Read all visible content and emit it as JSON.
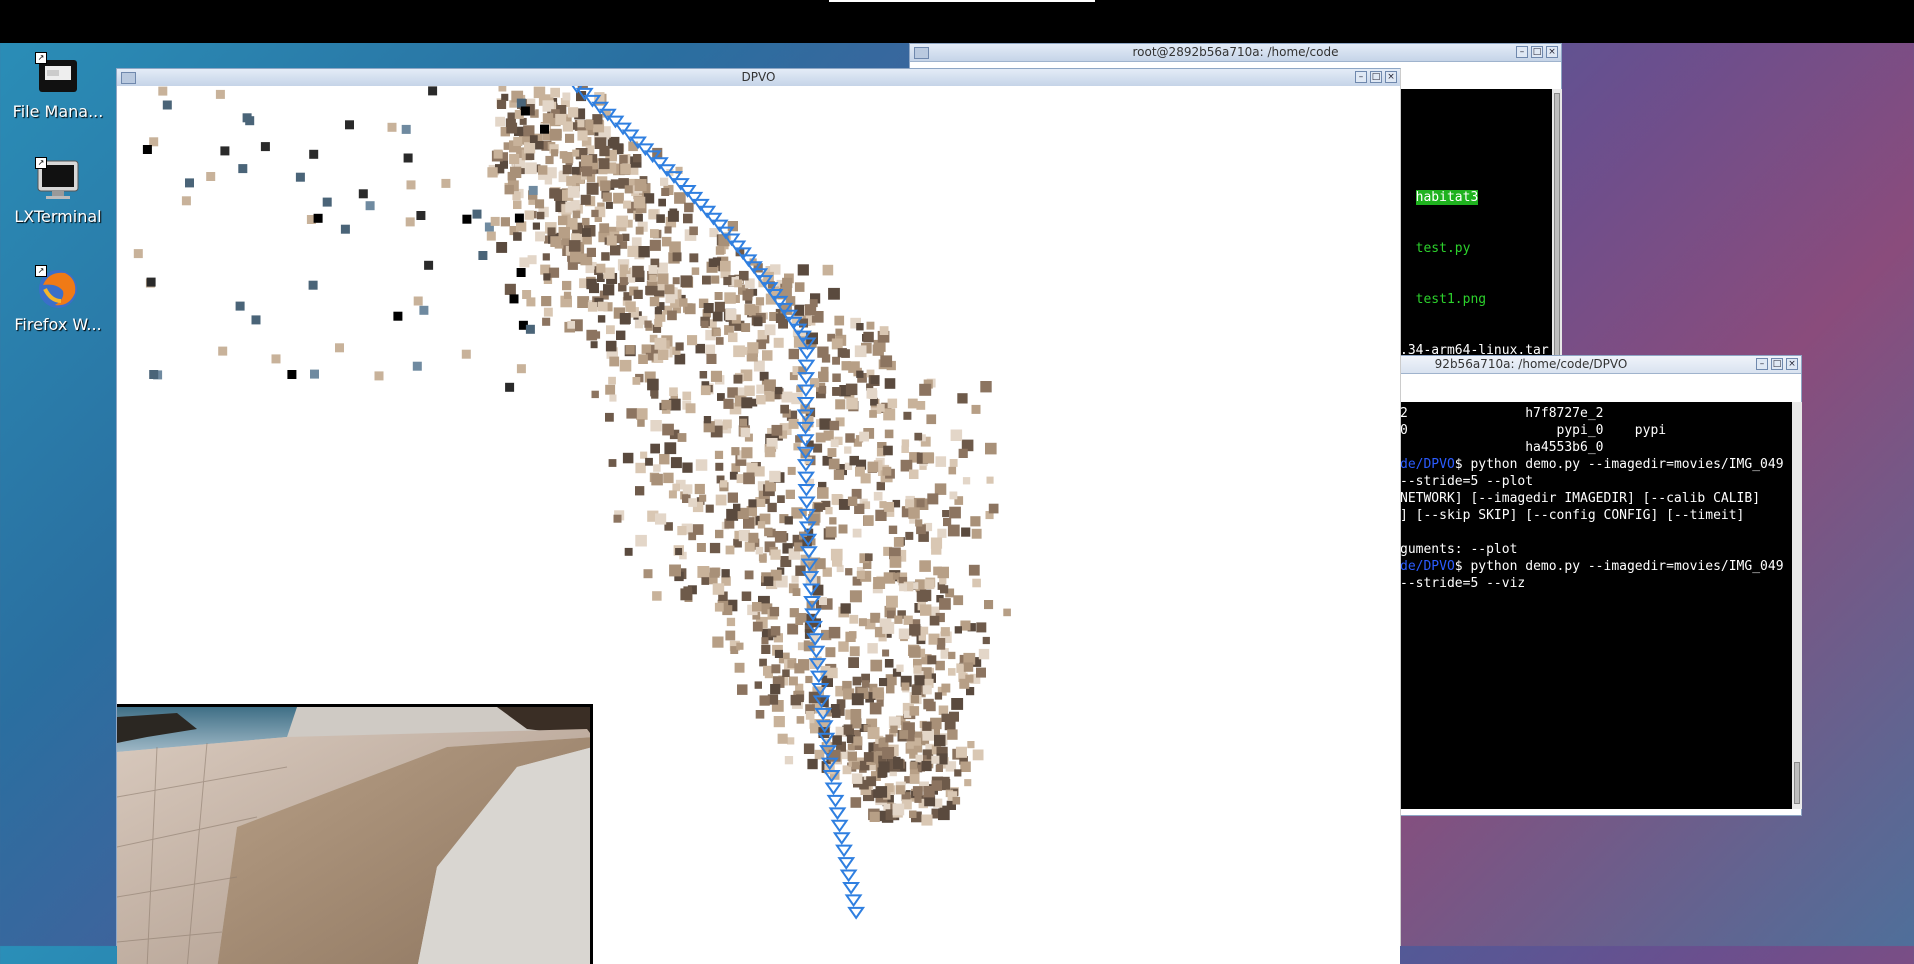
{
  "desktop": {
    "icons": [
      {
        "label": "File Mana...",
        "icon": "file-manager-icon"
      },
      {
        "label": "LXTerminal",
        "icon": "terminal-icon"
      },
      {
        "label": "Firefox W...",
        "icon": "firefox-icon"
      }
    ]
  },
  "terminal1": {
    "title": "root@2892b56a710a: /home/code",
    "lines": [
      {
        "text": "habitat3",
        "style": "highlight"
      },
      {
        "text": "test.py",
        "style": "green"
      },
      {
        "text": "test1.png",
        "style": "green"
      },
      {
        "text": ".34-arm64-linux.tar",
        "style": "plain"
      }
    ]
  },
  "terminal2": {
    "title": "92b56a710a: /home/code/DPVO",
    "lines": [
      {
        "prefix": "",
        "text": "2               h7f8727e_2"
      },
      {
        "prefix": "",
        "text": "0                   pypi_0    pypi"
      },
      {
        "prefix": "",
        "text": "                ha4553b6_0"
      },
      {
        "prefix": "de/DPVO",
        "text": "$ python demo.py --imagedir=movies/IMG_049"
      },
      {
        "prefix": "",
        "text": "--stride=5 --plot"
      },
      {
        "prefix": "",
        "text": "NETWORK] [--imagedir IMAGEDIR] [--calib CALIB]"
      },
      {
        "prefix": "",
        "text": "] [--skip SKIP] [--config CONFIG] [--timeit]"
      },
      {
        "prefix": "",
        "text": ""
      },
      {
        "prefix": "",
        "text": "guments: --plot"
      },
      {
        "prefix": "de/DPVO",
        "text": "$ python demo.py --imagedir=movies/IMG_049"
      },
      {
        "prefix": "",
        "text": "--stride=5 --viz"
      }
    ]
  },
  "dpvo": {
    "title": "DPVO",
    "trajectory_color": "#2f7fe0",
    "point_colors": [
      "#c8b29a",
      "#a89078",
      "#8c7460",
      "#d9c7b3",
      "#6e5a4a",
      "#b79f86",
      "#e3d6c8",
      "#5a4a3e"
    ]
  },
  "window_buttons": {
    "minimize": "–",
    "maximize": "□",
    "close": "×"
  }
}
